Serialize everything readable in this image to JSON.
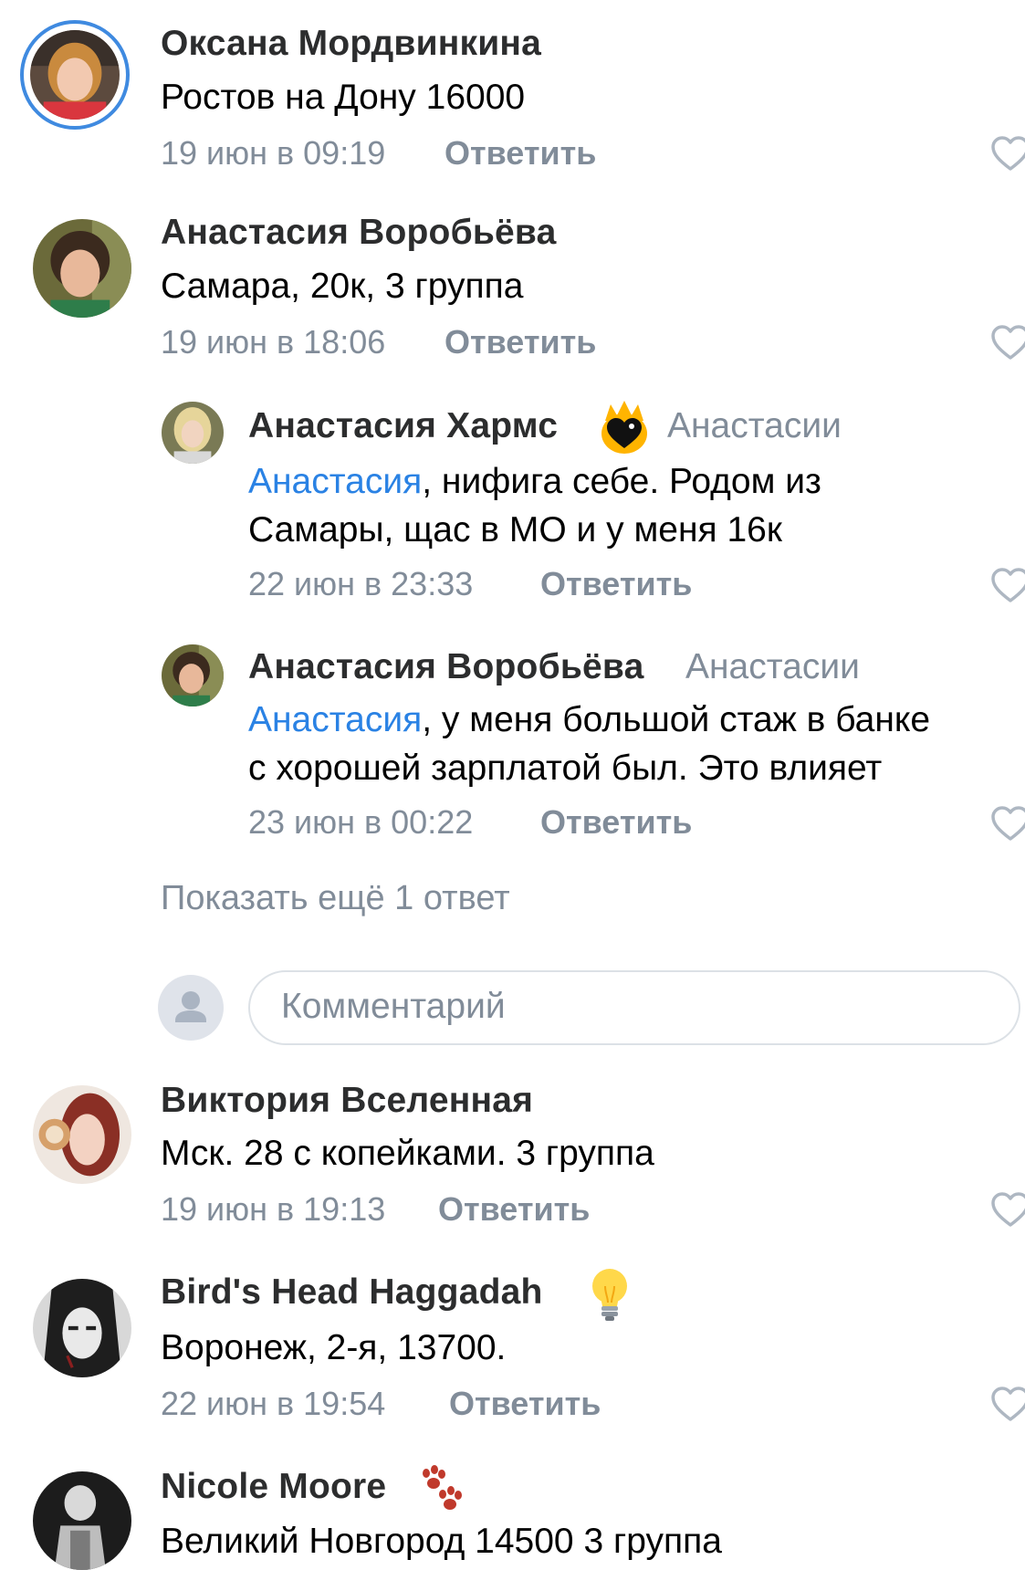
{
  "comments": [
    {
      "author": "Оксана Мордвинкина",
      "text": "Ростов на Дону 16000",
      "date": "19 июн в 09:19",
      "reply_label": "Ответить",
      "has_story_ring": true
    },
    {
      "author": "Анастасия Воробьёва",
      "text": "Самара, 20к, 3 группа",
      "date": "19 июн в 18:06",
      "reply_label": "Ответить",
      "replies": [
        {
          "author": "Анастасия Хармс",
          "badge": "black-heart-fire-icon",
          "reply_to": "Анастасии",
          "mention": "Анастасия",
          "text_line1": ", нифига себе. Родом из",
          "text_line2": "Самары, щас в МО и у меня 16к",
          "date": "22 июн в 23:33",
          "reply_label": "Ответить"
        },
        {
          "author": "Анастасия Воробьёва",
          "reply_to": "Анастасии",
          "mention": "Анастасия",
          "text_line1": ", у меня большой стаж в банке",
          "text_line2": "с хорошей зарплатой был. Это влияет",
          "date": "23 июн в 00:22",
          "reply_label": "Ответить"
        }
      ],
      "show_more": "Показать ещё 1 ответ",
      "comment_input_placeholder": "Комментарий"
    },
    {
      "author": "Виктория Вселенная",
      "text": "Мск. 28 с копейками. 3 группа",
      "date": "19 июн в 19:13",
      "reply_label": "Ответить"
    },
    {
      "author": "Bird's Head Haggadah",
      "badge": "light-bulb-icon",
      "text": "Воронеж, 2-я, 13700.",
      "date": "22 июн в 19:54",
      "reply_label": "Ответить"
    },
    {
      "author": "Nicole Moore",
      "badge": "paw-prints-icon",
      "text": "Великий Новгород 14500 3 группа"
    }
  ],
  "colors": {
    "link": "#2a82e4",
    "secondary_text": "#818c99",
    "name_text": "#2c2d2e",
    "story_ring": "#3f8ae0",
    "heart_outline": "#aeb7c2"
  }
}
